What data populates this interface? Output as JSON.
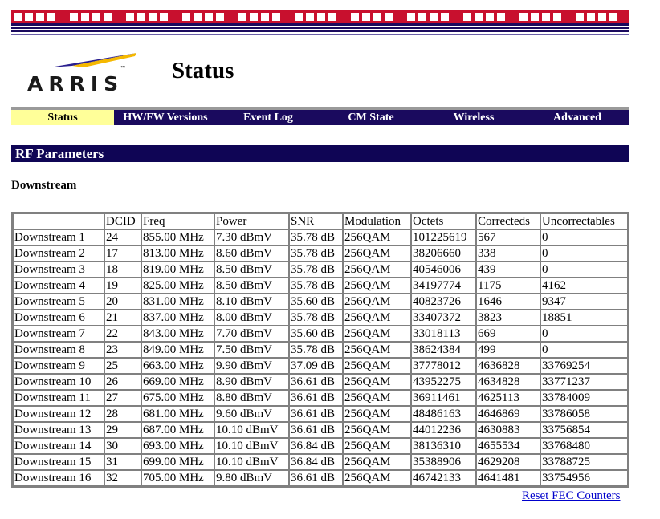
{
  "header": {
    "logo_text": "ARRIS",
    "logo_tm": "™",
    "title": "Status"
  },
  "nav": {
    "items": [
      {
        "label": "Status",
        "active": true
      },
      {
        "label": "HW/FW Versions",
        "active": false
      },
      {
        "label": "Event Log",
        "active": false
      },
      {
        "label": "CM State",
        "active": false
      },
      {
        "label": "Wireless",
        "active": false
      },
      {
        "label": "Advanced",
        "active": false
      }
    ]
  },
  "section": {
    "title": "RF Parameters",
    "subtitle": "Downstream"
  },
  "table": {
    "columns": [
      "",
      "DCID",
      "Freq",
      "Power",
      "SNR",
      "Modulation",
      "Octets",
      "Correcteds",
      "Uncorrectables"
    ],
    "rows": [
      [
        "Downstream 1",
        "24",
        "855.00 MHz",
        "7.30 dBmV",
        "35.78 dB",
        "256QAM",
        "101225619",
        "567",
        "0"
      ],
      [
        "Downstream 2",
        "17",
        "813.00 MHz",
        "8.60 dBmV",
        "35.78 dB",
        "256QAM",
        "38206660",
        "338",
        "0"
      ],
      [
        "Downstream 3",
        "18",
        "819.00 MHz",
        "8.50 dBmV",
        "35.78 dB",
        "256QAM",
        "40546006",
        "439",
        "0"
      ],
      [
        "Downstream 4",
        "19",
        "825.00 MHz",
        "8.50 dBmV",
        "35.78 dB",
        "256QAM",
        "34197774",
        "1175",
        "4162"
      ],
      [
        "Downstream 5",
        "20",
        "831.00 MHz",
        "8.10 dBmV",
        "35.60 dB",
        "256QAM",
        "40823726",
        "1646",
        "9347"
      ],
      [
        "Downstream 6",
        "21",
        "837.00 MHz",
        "8.00 dBmV",
        "35.78 dB",
        "256QAM",
        "33407372",
        "3823",
        "18851"
      ],
      [
        "Downstream 7",
        "22",
        "843.00 MHz",
        "7.70 dBmV",
        "35.60 dB",
        "256QAM",
        "33018113",
        "669",
        "0"
      ],
      [
        "Downstream 8",
        "23",
        "849.00 MHz",
        "7.50 dBmV",
        "35.78 dB",
        "256QAM",
        "38624384",
        "499",
        "0"
      ],
      [
        "Downstream 9",
        "25",
        "663.00 MHz",
        "9.90 dBmV",
        "37.09 dB",
        "256QAM",
        "37778012",
        "4636828",
        "33769254"
      ],
      [
        "Downstream 10",
        "26",
        "669.00 MHz",
        "8.90 dBmV",
        "36.61 dB",
        "256QAM",
        "43952275",
        "4634828",
        "33771237"
      ],
      [
        "Downstream 11",
        "27",
        "675.00 MHz",
        "8.80 dBmV",
        "36.61 dB",
        "256QAM",
        "36911461",
        "4625113",
        "33784009"
      ],
      [
        "Downstream 12",
        "28",
        "681.00 MHz",
        "9.60 dBmV",
        "36.61 dB",
        "256QAM",
        "48486163",
        "4646869",
        "33786058"
      ],
      [
        "Downstream 13",
        "29",
        "687.00 MHz",
        "10.10 dBmV",
        "36.61 dB",
        "256QAM",
        "44012236",
        "4630883",
        "33756854"
      ],
      [
        "Downstream 14",
        "30",
        "693.00 MHz",
        "10.10 dBmV",
        "36.84 dB",
        "256QAM",
        "38136310",
        "4655534",
        "33768480"
      ],
      [
        "Downstream 15",
        "31",
        "699.00 MHz",
        "10.10 dBmV",
        "36.84 dB",
        "256QAM",
        "35388906",
        "4629208",
        "33788725"
      ],
      [
        "Downstream 16",
        "32",
        "705.00 MHz",
        "9.80 dBmV",
        "36.61 dB",
        "256QAM",
        "46742133",
        "4641481",
        "33754956"
      ]
    ]
  },
  "actions": {
    "reset_label": "Reset FEC Counters"
  },
  "colors": {
    "banner_red": "#c8102e",
    "nav_bg": "#1a0a5e",
    "nav_active": "#ffff99",
    "section_bg": "#0f0555",
    "link": "#0000cc"
  }
}
